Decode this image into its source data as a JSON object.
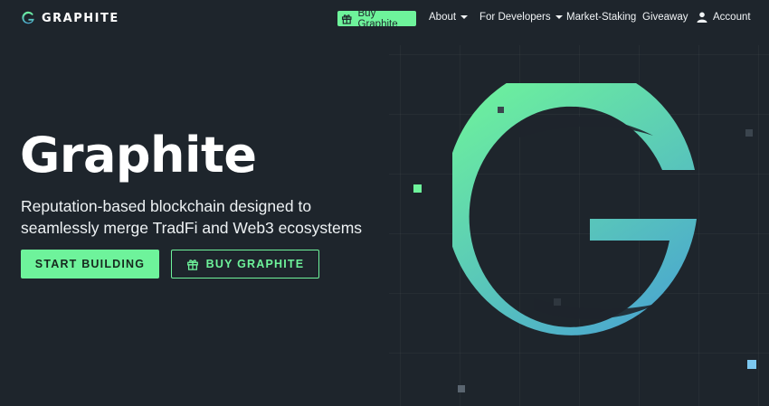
{
  "nav": {
    "logo_text": "GRAPHITE",
    "buy_label": "Buy Graphite",
    "about_label": "About",
    "developers_label": "For Developers",
    "staking_label": "Market-Staking",
    "giveaway_label": "Giveaway",
    "account_label": "Account",
    "icons": {
      "buy": "gift-icon",
      "account": "user-icon",
      "logo": "graphite-g-logo-icon"
    }
  },
  "hero": {
    "title": "Graphite",
    "subtitle": "Reputation-based blockchain designed to seamlessly merge TradFi and Web3 ecosystems",
    "primary_cta": "START BUILDING",
    "secondary_cta": "BUY GRAPHITE",
    "illustration": "graphite-g-emblem-icon"
  },
  "colors": {
    "background": "#1e252c",
    "accent_green": "#6ef39b",
    "gradient_blue": "#4aa6d0",
    "decor_blue": "#7cc8f0"
  }
}
